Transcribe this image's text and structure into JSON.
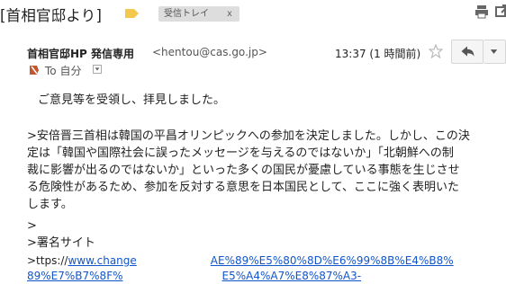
{
  "subject": "[首相官邸より]",
  "label_chip": {
    "text": "受信トレイ",
    "close": "x"
  },
  "sender": {
    "name": "首相官邸HP 発信専用",
    "email": "<hentou@cas.go.jp>",
    "time": "13:37 (1 時間前)",
    "to_label": "To 自分"
  },
  "body": {
    "greeting": "ご意見等を受領し、拝見しました。",
    "quote_lines": [
      ">安倍晋三首相は韓国の平昌オリンピックへの参加を決定しました。しかし、この決",
      "定は「韓国や国際社会に誤ったメッセージを与えるのではないか」「北朝鮮への制",
      "裁に影響が出るのではないか」といった多くの国民が憂慮している事態を生じさせ",
      "る危険性があるため、参加を反対する意思を日本国民として、ここに強く表明いた",
      "します。"
    ],
    "blank_quote": ">",
    "petition_label": ">署名サイト",
    "url_prefix": ">ttps://",
    "url_line1_left": "www.change",
    "url_line1_right": "AE%89%E5%80%8D%E6%99%8B%E4%B8%",
    "url_line2_left": "89%E7%B7%8F%",
    "url_line2_right": "E5%A4%A7%E8%87%A3-"
  },
  "icons": {
    "label_tag": "label-tag-icon",
    "print": "print-icon",
    "open_new_window": "open-new-window-icon",
    "star": "star-icon",
    "reply": "reply-icon",
    "more": "more-options-icon",
    "importance": "importance-marker-icon",
    "dropdown": "dropdown-arrow-icon"
  },
  "colors": {
    "tag": "#f2c94c",
    "link": "#1155cc",
    "chip_bg": "#dddddd"
  }
}
